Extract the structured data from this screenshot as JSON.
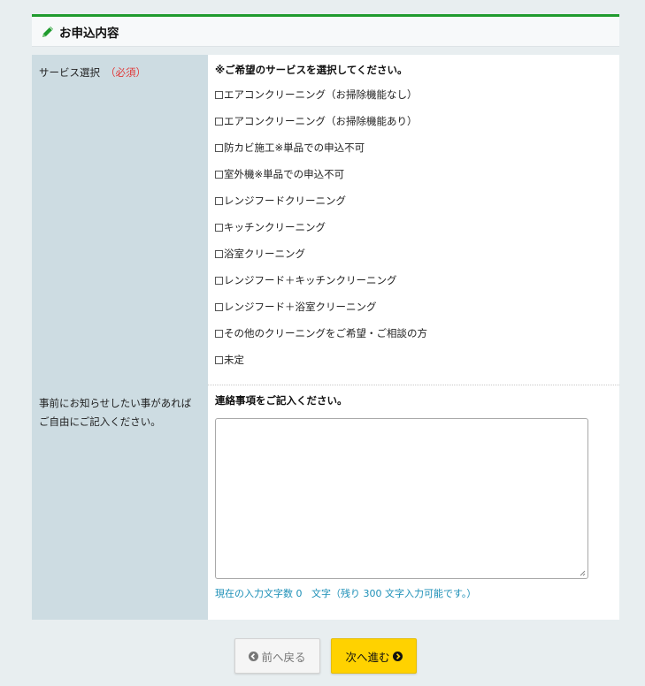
{
  "section": {
    "title": "お申込内容",
    "accent_color": "#1f9b2e",
    "icon": "pencil-icon"
  },
  "service_row": {
    "label": "サービス選択",
    "required": "（必須）",
    "instruction": "※ご希望のサービスを選択してください。",
    "options": [
      {
        "label": "エアコンクリーニング（お掃除機能なし）",
        "checked": false
      },
      {
        "label": "エアコンクリーニング（お掃除機能あり）",
        "checked": false
      },
      {
        "label": "防カビ施工※単品での申込不可",
        "checked": false
      },
      {
        "label": "室外機※単品での申込不可",
        "checked": false
      },
      {
        "label": "レンジフードクリーニング",
        "checked": false
      },
      {
        "label": "キッチンクリーニング",
        "checked": false
      },
      {
        "label": "浴室クリーニング",
        "checked": false
      },
      {
        "label": "レンジフード＋キッチンクリーニング",
        "checked": false
      },
      {
        "label": "レンジフード＋浴室クリーニング",
        "checked": false
      },
      {
        "label": "その他のクリーニングをご希望・ご相談の方",
        "checked": false
      },
      {
        "label": "未定",
        "checked": false
      }
    ]
  },
  "message_row": {
    "label": "事前にお知らせしたい事があればご自由にご記入ください。",
    "instruction": "連絡事項をご記入ください。",
    "textarea_value": "",
    "counter_prefix": "現在の入力文字数",
    "counter_count": "0",
    "counter_suffix": "文字（残り 300 文字入力可能です。）"
  },
  "buttons": {
    "back_label": "前へ戻る",
    "next_label": "次へ進む",
    "next_color": "#ffd200"
  }
}
